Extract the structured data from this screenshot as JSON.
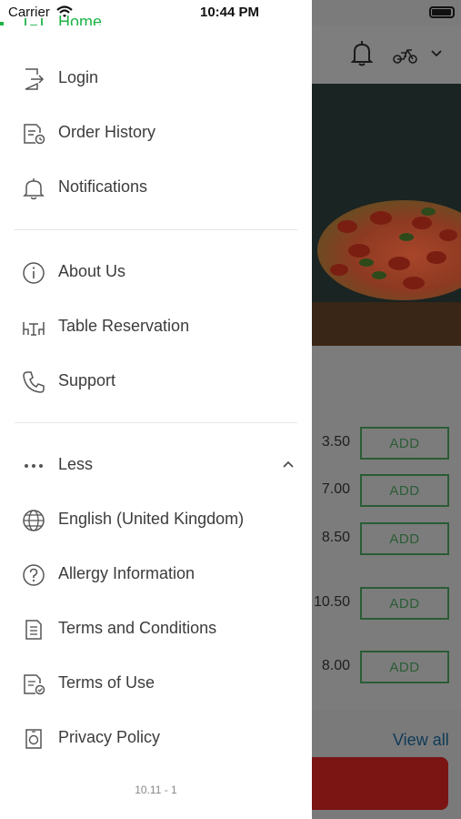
{
  "status_bar": {
    "carrier": "Carrier",
    "time": "10:44 PM"
  },
  "drawer": {
    "active_item": "Home",
    "items_group_1": [
      {
        "label": "Login",
        "icon": "login-icon"
      },
      {
        "label": "Order History",
        "icon": "order-history-icon"
      },
      {
        "label": "Notifications",
        "icon": "bell-icon"
      }
    ],
    "items_group_2": [
      {
        "label": "About Us",
        "icon": "info-icon"
      },
      {
        "label": "Table Reservation",
        "icon": "table-icon"
      },
      {
        "label": "Support",
        "icon": "phone-icon"
      }
    ],
    "more_toggle": {
      "label": "Less",
      "icon": "more-dots-icon"
    },
    "items_group_3": [
      {
        "label": "English (United Kingdom)",
        "icon": "globe-icon"
      },
      {
        "label": "Allergy Information",
        "icon": "question-icon"
      },
      {
        "label": "Terms and Conditions",
        "icon": "document-icon"
      },
      {
        "label": "Terms of Use",
        "icon": "document-check-icon"
      },
      {
        "label": "Privacy Policy",
        "icon": "privacy-icon"
      }
    ],
    "version": "10.11 - 1"
  },
  "background": {
    "prices": [
      "3.50",
      "7.00",
      "8.50",
      "10.50",
      "8.00"
    ],
    "add_label": "ADD",
    "view_all": "View all"
  },
  "colors": {
    "accent_green": "#1db347",
    "overlay_gray": "#7d7d7d"
  }
}
